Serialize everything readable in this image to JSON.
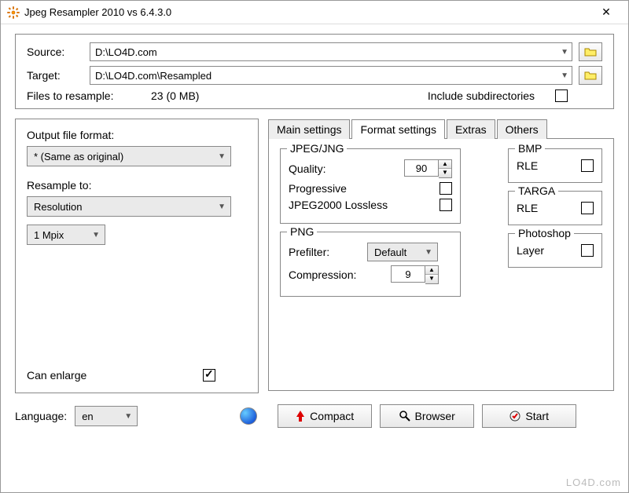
{
  "window": {
    "title": "Jpeg Resampler 2010 vs 6.4.3.0"
  },
  "paths": {
    "source_label": "Source:",
    "source": "D:\\LO4D.com",
    "target_label": "Target:",
    "target": "D:\\LO4D.com\\Resampled",
    "files_label": "Files to resample:",
    "files_value": "23 (0 MB)",
    "include_subdirs_label": "Include subdirectories"
  },
  "left": {
    "output_format_label": "Output file format:",
    "output_format_value": "* (Same as original)",
    "resample_to_label": "Resample to:",
    "resample_to_value": "Resolution",
    "mpix_value": "1 Mpix",
    "can_enlarge_label": "Can enlarge"
  },
  "tabs": {
    "main": "Main settings",
    "format": "Format settings",
    "extras": "Extras",
    "others": "Others"
  },
  "format": {
    "jpeg_legend": "JPEG/JNG",
    "quality_label": "Quality:",
    "quality_value": "90",
    "progressive_label": "Progressive",
    "jpeg2000_label": "JPEG2000 Lossless",
    "png_legend": "PNG",
    "prefilter_label": "Prefilter:",
    "prefilter_value": "Default",
    "compression_label": "Compression:",
    "compression_value": "9",
    "bmp_legend": "BMP",
    "bmp_rle_label": "RLE",
    "targa_legend": "TARGA",
    "targa_rle_label": "RLE",
    "photoshop_legend": "Photoshop",
    "photoshop_layer_label": "Layer"
  },
  "bottom": {
    "language_label": "Language:",
    "language_value": "en",
    "compact": "Compact",
    "browser": "Browser",
    "start": "Start"
  },
  "watermark": "LO4D.com"
}
